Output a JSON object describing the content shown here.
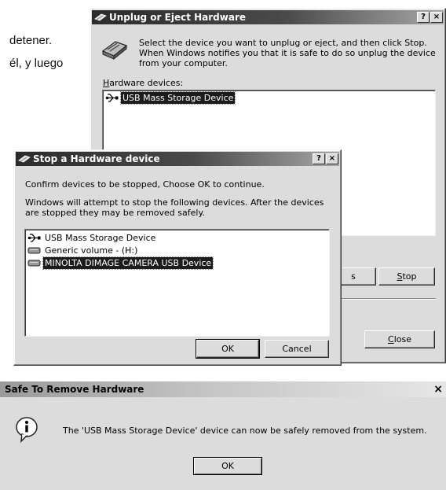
{
  "background_text": {
    "line1": "detener.",
    "line2": "él, y luego"
  },
  "unplug_dialog": {
    "title": "Unplug or Eject Hardware",
    "help_btn": "?",
    "close_btn": "×",
    "instruction": "Select the device you want to unplug or eject, and then click Stop. When Windows notifies you that it is safe to do so unplug the device from your computer.",
    "devices_label_accel": "H",
    "devices_label_rest": "ardware devices:",
    "devices": [
      {
        "label": "USB Mass Storage Device",
        "icon": "usb-icon",
        "selected": true
      }
    ],
    "partial_button": "s",
    "stop_accel": "S",
    "stop_rest": "top",
    "close_accel": "C",
    "close_rest": "lose"
  },
  "stop_dialog": {
    "title": "Stop a Hardware device",
    "help_btn": "?",
    "close_btn": "×",
    "confirm_text": "Confirm devices to be stopped, Choose OK to continue.",
    "info_text": "Windows will attempt to stop the following devices. After the devices are stopped they may be removed safely.",
    "devices": [
      {
        "label": "USB Mass Storage Device",
        "icon": "usb-icon",
        "selected": false
      },
      {
        "label": "Generic volume - (H:)",
        "icon": "drive-icon",
        "selected": false
      },
      {
        "label": "MINOLTA DIMAGE CAMERA USB Device",
        "icon": "drive-icon",
        "selected": true
      }
    ],
    "ok_label": "OK",
    "cancel_label": "Cancel"
  },
  "safe_dialog": {
    "title": "Safe To Remove Hardware",
    "close_btn": "×",
    "message": "The 'USB Mass Storage Device' device can now be safely removed from the system.",
    "ok_label": "OK",
    "icon": "info-icon"
  }
}
